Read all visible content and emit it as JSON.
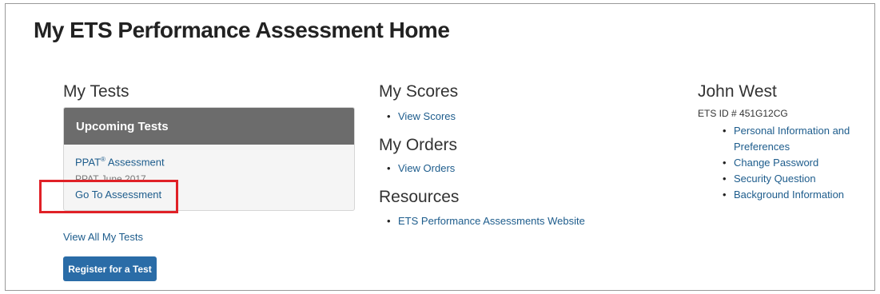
{
  "page": {
    "title": "My ETS Performance Assessment Home"
  },
  "my_tests": {
    "heading": "My Tests",
    "card_header": "Upcoming Tests",
    "test_name": "PPAT",
    "test_name_mark": "®",
    "test_name_suffix": " Assessment",
    "test_date": "PPAT June 2017",
    "go_link": "Go To Assessment",
    "view_all": "View All My Tests",
    "register_button": "Register for a Test"
  },
  "my_scores": {
    "heading": "My Scores",
    "links": [
      "View Scores"
    ]
  },
  "my_orders": {
    "heading": "My Orders",
    "links": [
      "View Orders"
    ]
  },
  "resources": {
    "heading": "Resources",
    "links": [
      "ETS Performance Assessments Website"
    ]
  },
  "profile": {
    "name": "John West",
    "ets_id": "ETS ID # 451G12CG",
    "links": [
      "Personal Information and Preferences",
      "Change Password",
      "Security Question",
      "Background Information"
    ]
  },
  "colors": {
    "link": "#1d5c8c",
    "card_header": "#6c6c6c",
    "button": "#2a6ca7",
    "highlight": "#e02127"
  }
}
